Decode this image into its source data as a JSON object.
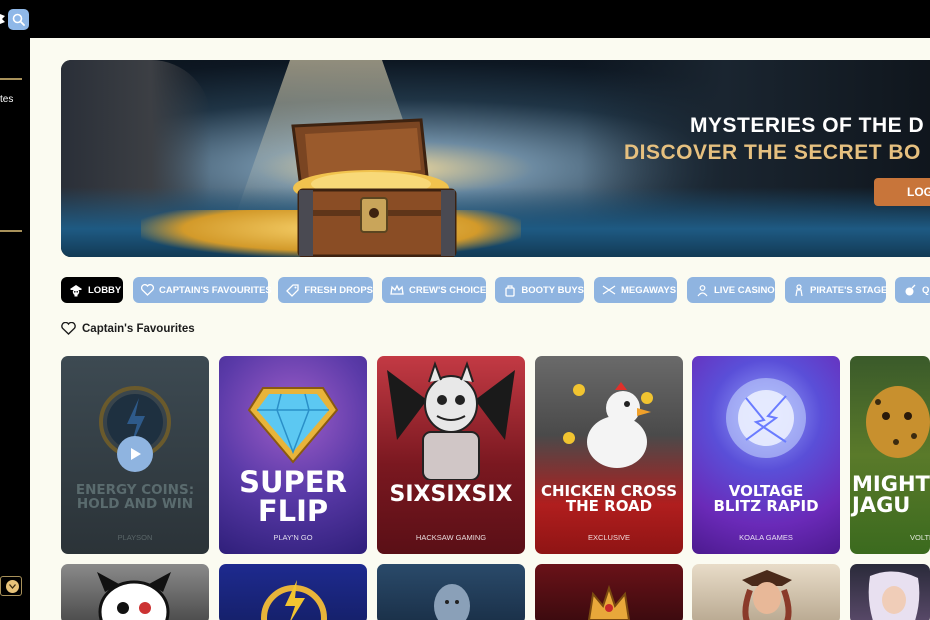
{
  "app": {
    "search_icon": "search-icon",
    "sidebar_label_fragment": "tes"
  },
  "hero": {
    "title": "MYSTERIES OF THE D",
    "subtitle": "DISCOVER THE SECRET BO",
    "cta": "LOG"
  },
  "tabs": [
    {
      "label": "LOBBY",
      "icon": "pirate-skull-icon",
      "active": true
    },
    {
      "label": "CAPTAIN'S FAVOURITES",
      "icon": "heart-icon"
    },
    {
      "label": "FRESH DROPS",
      "icon": "tag-icon"
    },
    {
      "label": "CREW'S CHOICE",
      "icon": "crown-icon"
    },
    {
      "label": "BOOTY BUYS",
      "icon": "bag-icon"
    },
    {
      "label": "MEGAWAYS",
      "icon": "ways-icon"
    },
    {
      "label": "LIVE CASINO",
      "icon": "live-dealer-icon"
    },
    {
      "label": "PIRATE'S STAGE",
      "icon": "stage-icon"
    },
    {
      "label": "Q",
      "icon": "bomb-icon"
    }
  ],
  "section": {
    "title": "Captain's Favourites",
    "icon": "heart-icon"
  },
  "games": [
    {
      "name_line1": "ENERGY COINS:",
      "name_line2": "HOLD AND WIN",
      "provider": "PLAYSON",
      "disabled": true
    },
    {
      "name_line1": "SUPER",
      "name_line2": "FLIP",
      "provider": "PLAY'N GO"
    },
    {
      "name_line1": "SIXSIXSIX",
      "name_line2": "",
      "provider": "HACKSAW GAMING"
    },
    {
      "name_line1": "CHICKEN CROSS",
      "name_line2": "THE ROAD",
      "provider": "EXCLUSIVE"
    },
    {
      "name_line1": "VOLTAGE",
      "name_line2": "BLITZ RAPID",
      "provider": "KOALA GAMES"
    },
    {
      "name_line1": "MIGHTY",
      "name_line2": "JAGU",
      "provider": "VOLTE"
    }
  ],
  "colors": {
    "accent_blue": "#8fb4e0",
    "gold": "#e6c07f",
    "cta_orange": "#c8753a",
    "page_bg": "#fbfbf1"
  }
}
